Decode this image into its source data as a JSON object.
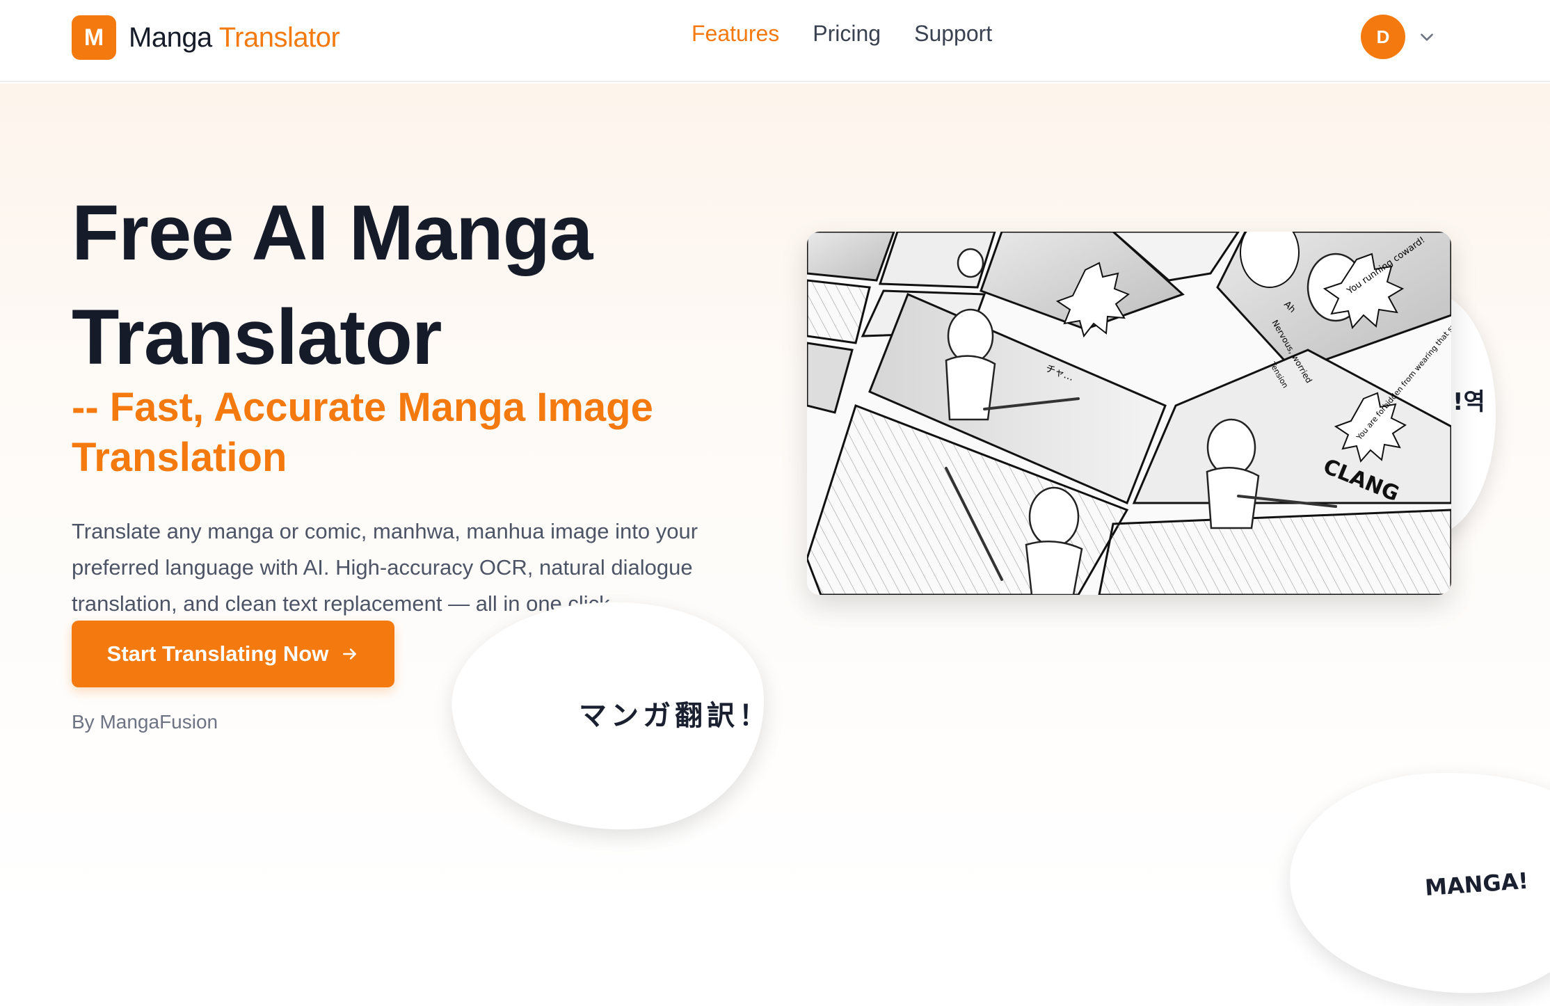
{
  "nav": {
    "logo_letter": "M",
    "logo_word1": "Manga",
    "logo_word2": "Translator",
    "links": [
      "Features",
      "Pricing",
      "Support"
    ],
    "active_link": "Features",
    "avatar_initial": "D",
    "avatar_menu_icon": "chevron-down-icon"
  },
  "hero": {
    "title_line1": "Free AI Manga",
    "title_line2": "Translator",
    "subtitle_line1": "-- Fast, Accurate Manga Image",
    "subtitle_line2": "Translation",
    "description": "Translate any manga or comic, manhwa, manhua image into your preferred language with AI. High-accuracy OCR, natural dialogue translation, and clean text replacement — all in one click.",
    "cta_label": "Start Translating Now",
    "cta_icon": "arrow-right-icon",
    "byline": "By MangaFusion"
  },
  "bubbles": {
    "japanese": "マンガ翻訳！",
    "korean": "!역",
    "manga": "MANGA!"
  },
  "preview": {
    "panel_sfx": "CLANG",
    "bubble_text_1": "Ah",
    "bubble_text_2": "Nervous, worried",
    "bubble_text_3": "You running coward!",
    "bubble_text_4": "Tension",
    "bubble_text_5": "You are forbidden from wearing that sword!",
    "sfx_small": "チャ…"
  },
  "colors": {
    "accent": "#f47a0f",
    "heading": "#161b29",
    "body_text": "#4c5466"
  }
}
